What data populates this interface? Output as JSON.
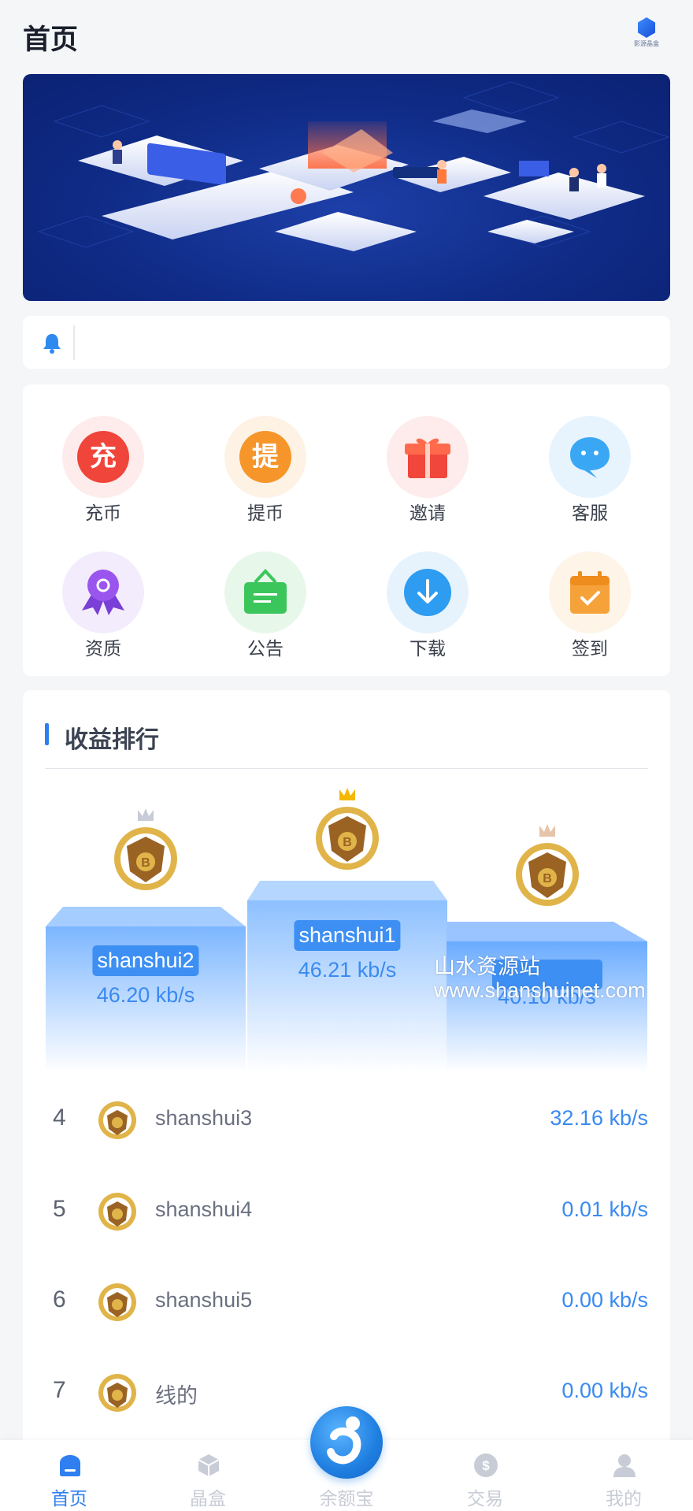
{
  "header": {
    "title": "首页",
    "logo_text": "影源晶盒"
  },
  "notice": {
    "text": ""
  },
  "quick_actions": [
    {
      "label": "充币",
      "glyph": "充",
      "icon": "recharge-icon",
      "color": "#f0453a"
    },
    {
      "label": "提币",
      "glyph": "提",
      "icon": "withdraw-icon",
      "color": "#f6962a"
    },
    {
      "label": "邀请",
      "glyph": "",
      "icon": "gift-icon",
      "color": "#f0463b"
    },
    {
      "label": "客服",
      "glyph": "",
      "icon": "chat-icon",
      "color": "#3aa7f4"
    },
    {
      "label": "资质",
      "glyph": "",
      "icon": "award-icon",
      "color": "#8e47e6"
    },
    {
      "label": "公告",
      "glyph": "",
      "icon": "notice-board-icon",
      "color": "#3bc65b"
    },
    {
      "label": "下载",
      "glyph": "",
      "icon": "download-icon",
      "color": "#2e9cf1"
    },
    {
      "label": "签到",
      "glyph": "",
      "icon": "calendar-check-icon",
      "color": "#f5a23a"
    }
  ],
  "ranking": {
    "title": "收益排行",
    "podium": [
      {
        "rank": 2,
        "name": "shanshui2",
        "speed": "46.20 kb/s"
      },
      {
        "rank": 1,
        "name": "shanshui1",
        "speed": "46.21 kb/s"
      },
      {
        "rank": 3,
        "name": "",
        "speed": "40.10 kb/s"
      }
    ],
    "list": [
      {
        "rank": "4",
        "name": "shanshui3",
        "speed": "32.16 kb/s"
      },
      {
        "rank": "5",
        "name": "shanshui4",
        "speed": "0.01 kb/s"
      },
      {
        "rank": "6",
        "name": "shanshui5",
        "speed": "0.00 kb/s"
      },
      {
        "rank": "7",
        "name": "线的",
        "speed": "0.00 kb/s"
      }
    ]
  },
  "watermark": {
    "line1": "山水资源站",
    "line2": "www.shanshuinet.com"
  },
  "tabbar": [
    {
      "label": "首页",
      "icon": "home-icon",
      "active": true
    },
    {
      "label": "晶盒",
      "icon": "cube-icon",
      "active": false
    },
    {
      "label": "余额宝",
      "icon": "wallet-logo-icon",
      "active": false
    },
    {
      "label": "交易",
      "icon": "dollar-coin-icon",
      "active": false
    },
    {
      "label": "我的",
      "icon": "user-icon",
      "active": false
    }
  ]
}
